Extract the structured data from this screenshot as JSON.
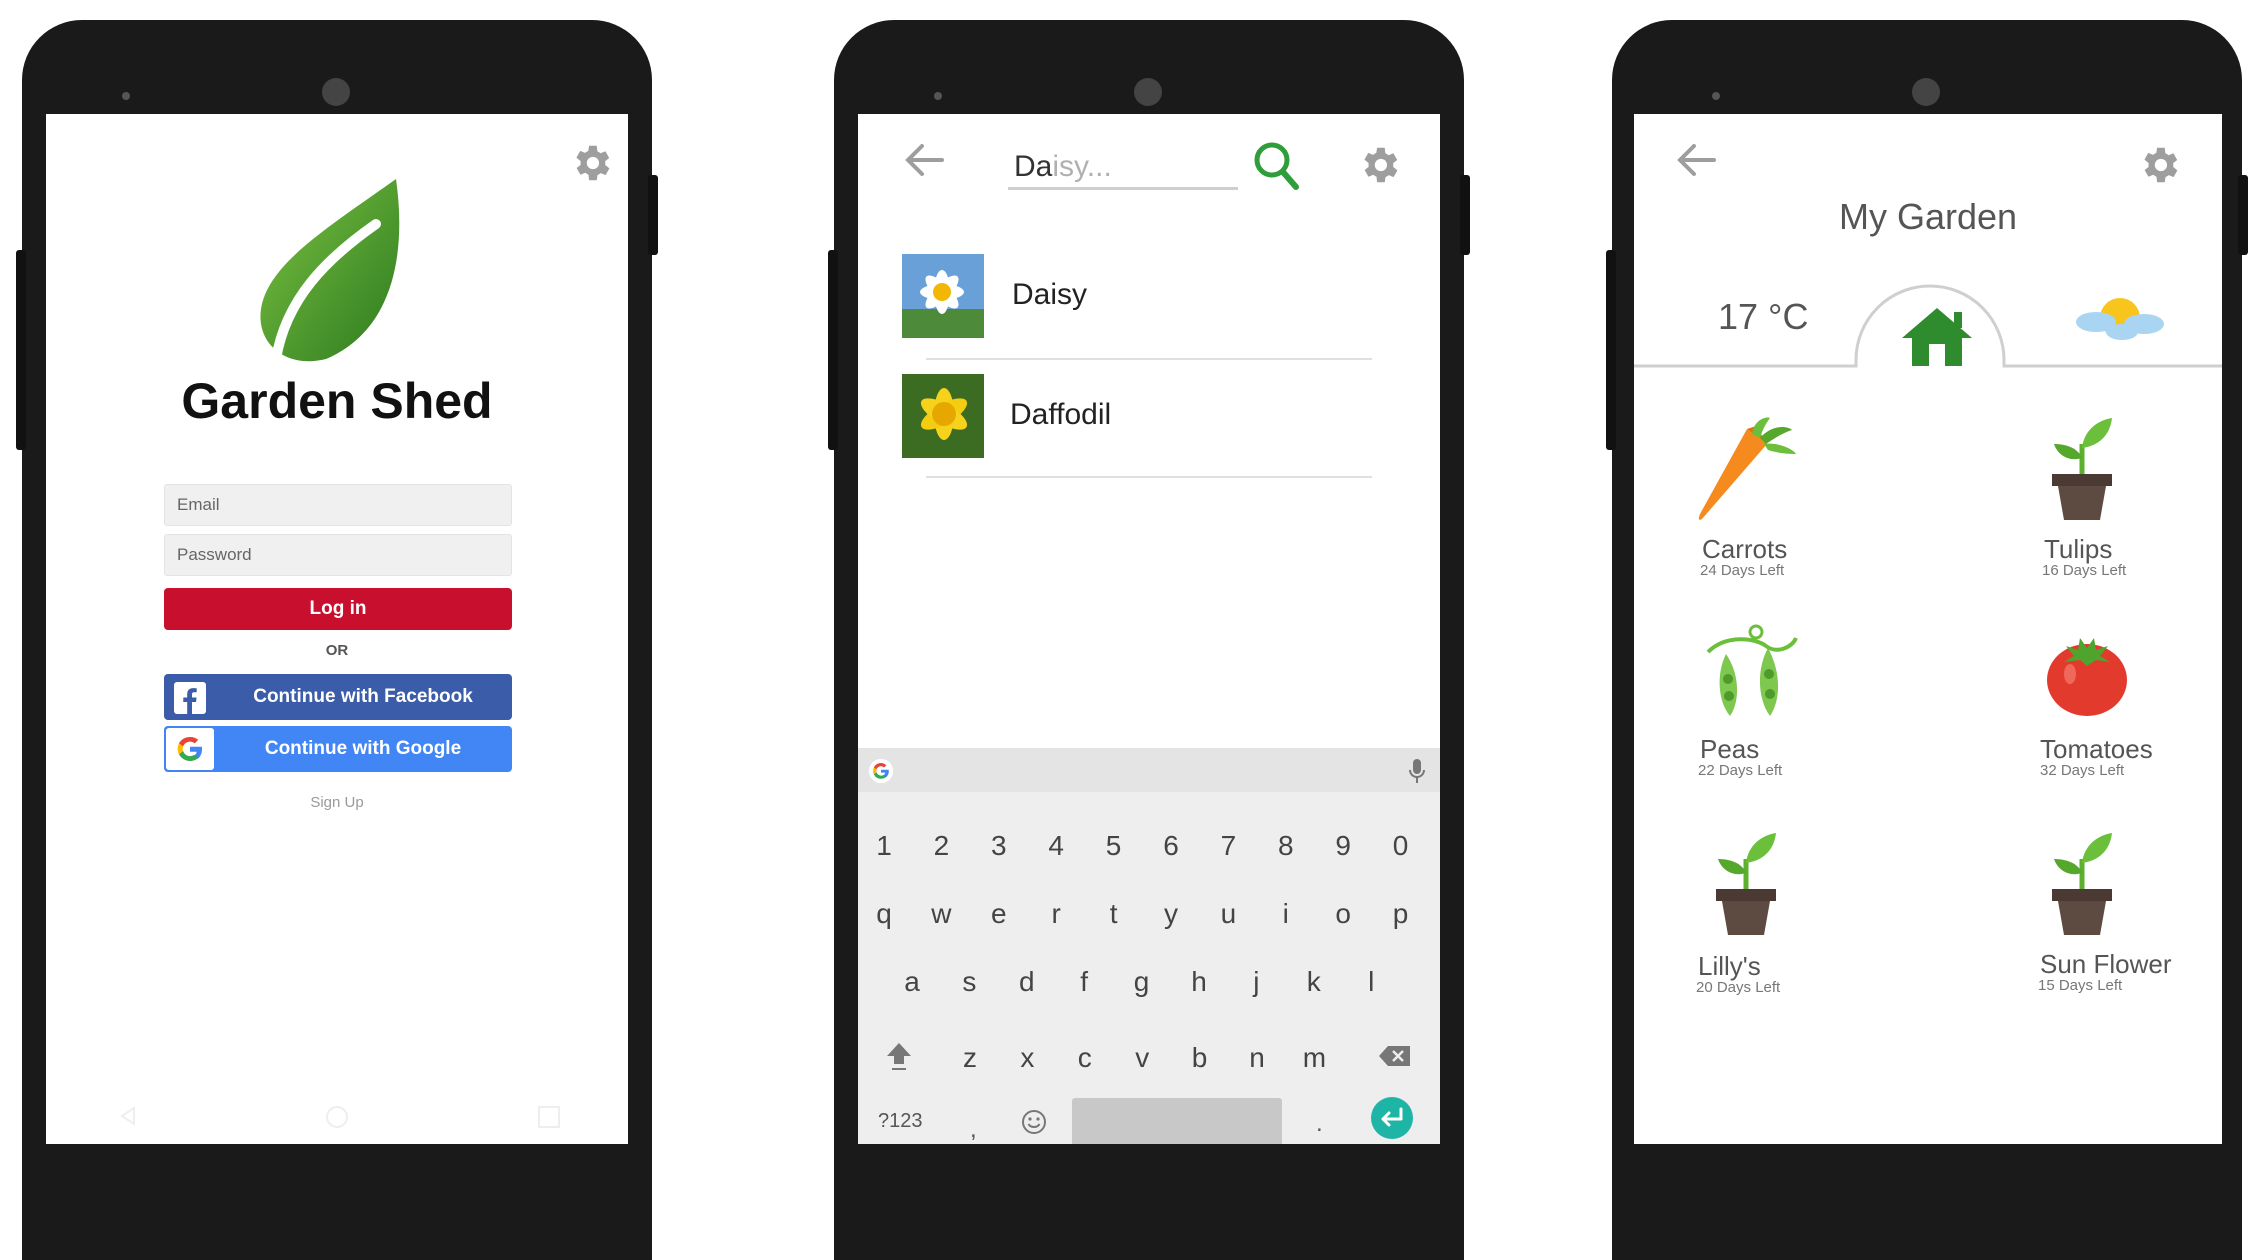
{
  "login": {
    "app_name": "Garden Shed",
    "email_placeholder": "Email",
    "password_placeholder": "Password",
    "login_label": "Log in",
    "or_label": "OR",
    "facebook_label": "Continue with Facebook",
    "google_label": "Continue with Google",
    "signup_label": "Sign Up"
  },
  "search": {
    "query_typed": "Da",
    "query_suggest": "isy...",
    "results": [
      {
        "name": "Daisy"
      },
      {
        "name": "Daffodil"
      }
    ],
    "keyboard": {
      "digits": [
        "1",
        "2",
        "3",
        "4",
        "5",
        "6",
        "7",
        "8",
        "9",
        "0"
      ],
      "row1": [
        "q",
        "w",
        "e",
        "r",
        "t",
        "y",
        "u",
        "i",
        "o",
        "p"
      ],
      "row2": [
        "a",
        "s",
        "d",
        "f",
        "g",
        "h",
        "j",
        "k",
        "l"
      ],
      "row3": [
        "z",
        "x",
        "c",
        "v",
        "b",
        "n",
        "m"
      ],
      "symbols_label": "?123",
      "comma": ",",
      "period": "."
    }
  },
  "garden": {
    "title": "My Garden",
    "temperature": "17 °C",
    "plants": [
      {
        "name": "Carrots",
        "days": "24 Days Left"
      },
      {
        "name": "Tulips",
        "days": "16 Days Left"
      },
      {
        "name": "Peas",
        "days": "22 Days Left"
      },
      {
        "name": "Tomatoes",
        "days": "32 Days Left"
      },
      {
        "name": "Lilly's",
        "days": "20 Days Left"
      },
      {
        "name": "Sun Flower",
        "days": "15 Days Left"
      }
    ]
  },
  "colors": {
    "login_red": "#c8102e",
    "facebook_blue": "#3b5ca8",
    "google_blue": "#4285f4",
    "search_green": "#2e9e3a",
    "enter_teal": "#1fb5a6",
    "leaf_green": "#4a9a2b"
  },
  "icons": {
    "settings": "gear-icon",
    "back": "arrow-left-icon",
    "search": "magnifier-icon",
    "home": "house-icon",
    "weather": "sun-cloud-icon",
    "mic": "microphone-icon"
  }
}
